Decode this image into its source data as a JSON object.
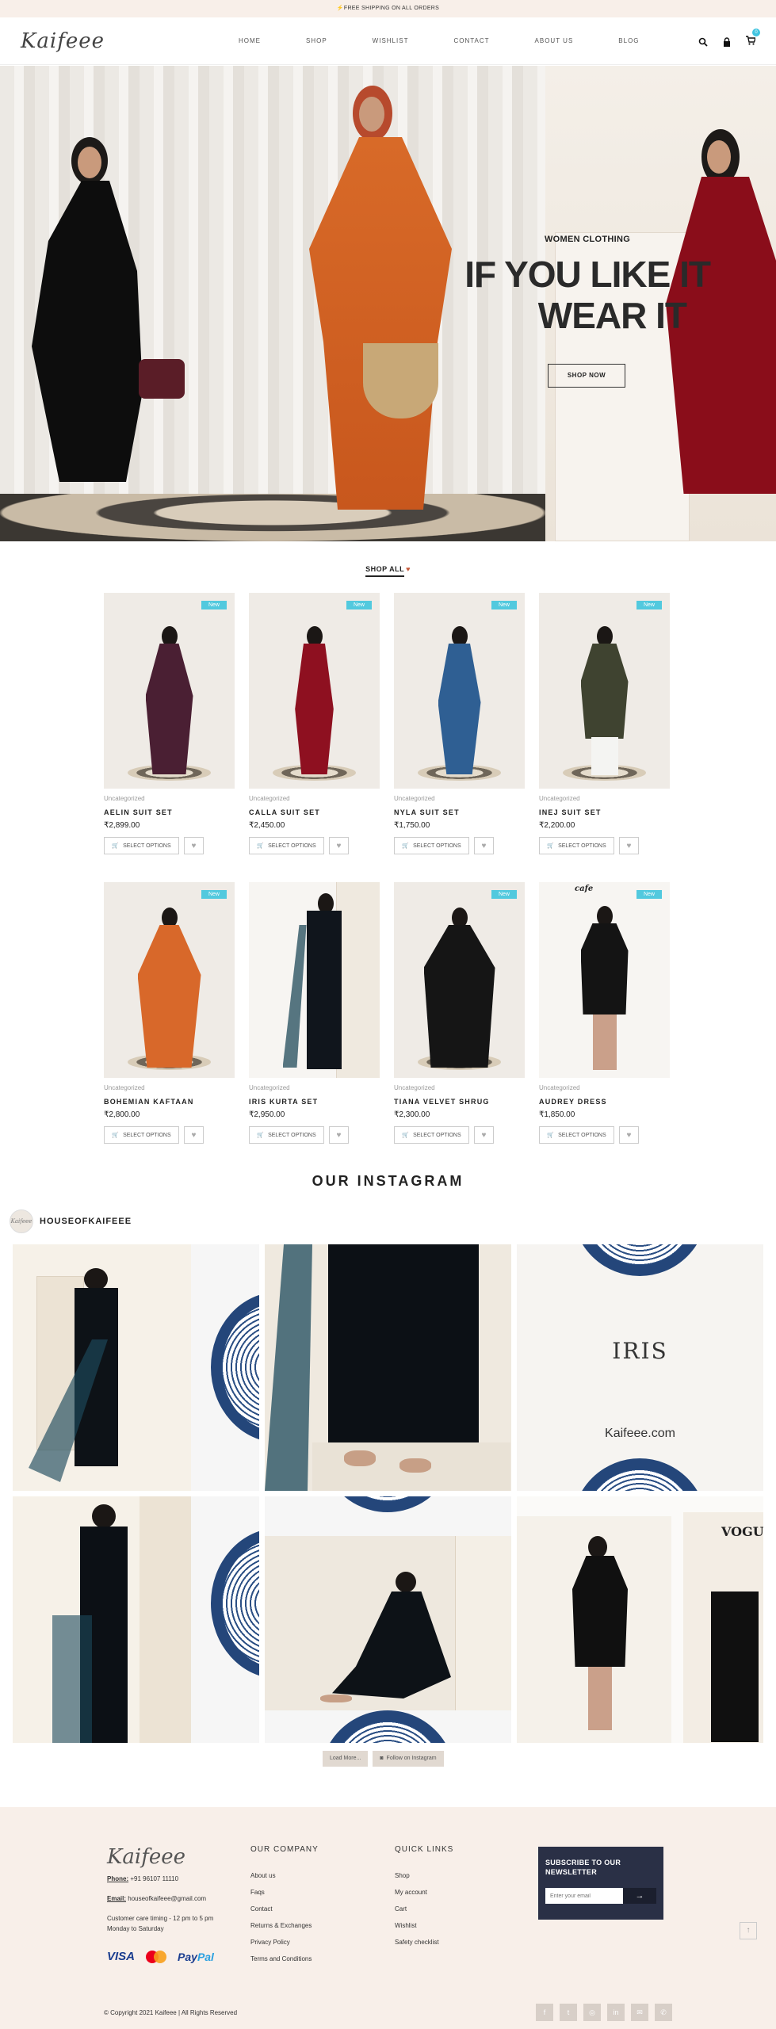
{
  "topbar": {
    "text": "⚡FREE SHIPPING ON ALL ORDERS"
  },
  "header": {
    "logo": "Kaifeee",
    "nav": [
      "HOME",
      "SHOP",
      "WISHLIST",
      "CONTACT",
      "ABOUT US",
      "BLOG"
    ],
    "cart_count": "0"
  },
  "hero": {
    "subtitle": "WOMEN CLOTHING",
    "title_line1": "IF YOU LIKE IT",
    "title_line2": "WEAR IT",
    "button": "SHOP NOW"
  },
  "shop_all": {
    "label": "SHOP ALL"
  },
  "products": [
    {
      "name": "AELIN SUIT SET",
      "category": "Uncategorized",
      "price": "₹2,899.00",
      "badge": "New",
      "button": "SELECT OPTIONS",
      "dress_color": "#4a1f33"
    },
    {
      "name": "CALLA SUIT SET",
      "category": "Uncategorized",
      "price": "₹2,450.00",
      "badge": "New",
      "button": "SELECT OPTIONS",
      "dress_color": "#8e1020"
    },
    {
      "name": "NYLA SUIT SET",
      "category": "Uncategorized",
      "price": "₹1,750.00",
      "badge": "New",
      "button": "SELECT OPTIONS",
      "dress_color": "#2f5f93"
    },
    {
      "name": "INEJ SUIT SET",
      "category": "Uncategorized",
      "price": "₹2,200.00",
      "badge": "New",
      "button": "SELECT OPTIONS",
      "dress_color": "#3f4330"
    },
    {
      "name": "BOHEMIAN KAFTAAN",
      "category": "Uncategorized",
      "price": "₹2,800.00",
      "badge": "New",
      "button": "SELECT OPTIONS",
      "dress_color": "#d8682a"
    },
    {
      "name": "IRIS KURTA SET",
      "category": "Uncategorized",
      "price": "₹2,950.00",
      "badge": "",
      "button": "SELECT OPTIONS",
      "dress_color": "#10151c"
    },
    {
      "name": "TIANA VELVET SHRUG",
      "category": "Uncategorized",
      "price": "₹2,300.00",
      "badge": "New",
      "button": "SELECT OPTIONS",
      "dress_color": "#151515"
    },
    {
      "name": "AUDREY DRESS",
      "category": "Uncategorized",
      "price": "₹1,850.00",
      "badge": "New",
      "button": "SELECT OPTIONS",
      "dress_color": "#141414"
    }
  ],
  "instagram": {
    "title": "OUR INSTAGRAM",
    "handle": "HOUSEOFKAIFEEE",
    "avatar_text": "Kaifeee",
    "tile_text": {
      "brand": "IRIS",
      "site": "Kaifeee.com",
      "vogue": "VOGUE",
      "cafe": "cafe"
    },
    "load_more": "Load More...",
    "follow": "Follow on Instagram"
  },
  "footer": {
    "logo": "Kaifeee",
    "phone_label": "Phone:",
    "phone": "+91 96107 11110",
    "email_label": "Email:",
    "email": "houseofkaifeee@gmail.com",
    "care_line1": "Customer care timing - 12 pm to 5 pm",
    "care_line2": "Monday to Saturday",
    "pay_visa": "VISA",
    "pay_paypal_a": "Pay",
    "pay_paypal_b": "Pal",
    "company_title": "OUR COMPANY",
    "company_links": [
      "About us",
      "Faqs",
      "Contact",
      "Returns & Exchanges",
      "Privacy Policy",
      "Terms and Conditions"
    ],
    "quick_title": "QUICK LINKS",
    "quick_links": [
      "Shop",
      "My account",
      "Cart",
      "Wishlist",
      "Safety checklist"
    ],
    "subscribe_title_1": "SUBSCRIBE TO OUR",
    "subscribe_title_2": "NEWSLETTER",
    "email_placeholder": "Enter your email",
    "subscribe_arrow": "→",
    "backtop": "↑",
    "copyright": "© Copyright 2021 Kaifeee | All Rights Reserved",
    "socials": [
      "f",
      "t",
      "◎",
      "in",
      "✉",
      "✆"
    ]
  }
}
